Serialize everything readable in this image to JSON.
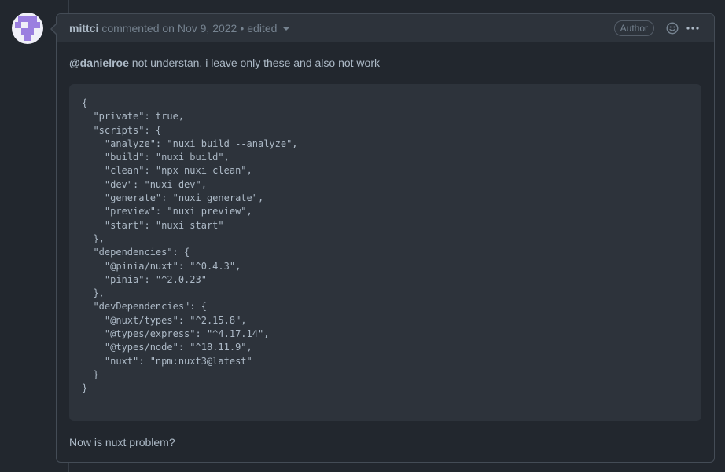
{
  "comment": {
    "author": "mittci",
    "action": "commented on Nov 9, 2022",
    "separator": "•",
    "edited_label": "edited",
    "badge": "Author",
    "icons": {
      "reaction": "smiley-icon",
      "more": "kebab-horizontal-icon",
      "dropdown": "triangle-down-icon"
    },
    "body": {
      "mention": "@danielroe",
      "message": " not understan, i leave only these and also not work",
      "code": "{\n  \"private\": true,\n  \"scripts\": {\n    \"analyze\": \"nuxi build --analyze\",\n    \"build\": \"nuxi build\",\n    \"clean\": \"npx nuxi clean\",\n    \"dev\": \"nuxi dev\",\n    \"generate\": \"nuxi generate\",\n    \"preview\": \"nuxi preview\",\n    \"start\": \"nuxi start\"\n  },\n  \"dependencies\": {\n    \"@pinia/nuxt\": \"^0.4.3\",\n    \"pinia\": \"^2.0.23\"\n  },\n  \"devDependencies\": {\n    \"@nuxt/types\": \"^2.15.8\",\n    \"@types/express\": \"^4.17.14\",\n    \"@types/node\": \"^18.11.9\",\n    \"nuxt\": \"npm:nuxt3@latest\"\n  }\n}",
      "closing": "Now is nuxt problem?"
    }
  },
  "colors": {
    "background": "#22272e",
    "header_bg": "#2d333b",
    "border": "#444c56",
    "text": "#adbac7",
    "muted": "#768390",
    "avatar_accent": "#9b7fe0"
  }
}
